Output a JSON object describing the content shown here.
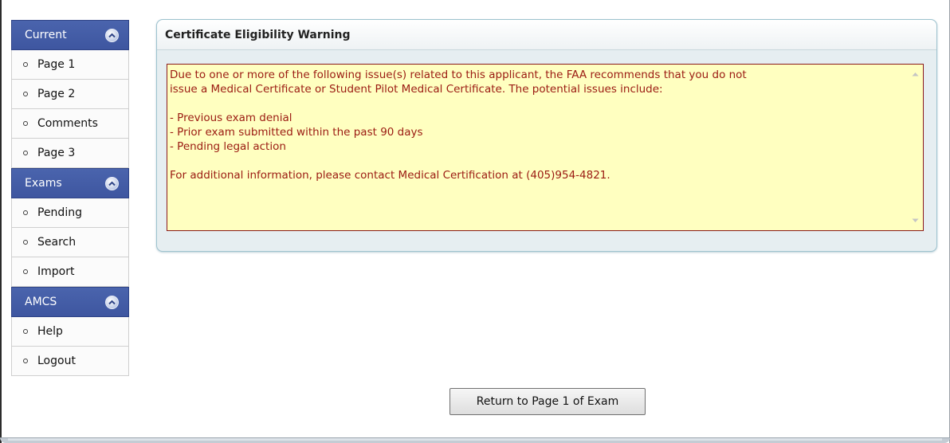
{
  "sidebar": {
    "sections": [
      {
        "title": "Current",
        "items": [
          "Page 1",
          "Page 2",
          "Comments",
          "Page 3"
        ]
      },
      {
        "title": "Exams",
        "items": [
          "Pending",
          "Search",
          "Import"
        ]
      },
      {
        "title": "AMCS",
        "items": [
          "Help",
          "Logout"
        ]
      }
    ]
  },
  "warning_panel": {
    "title": "Certificate Eligibility Warning",
    "message": "Due to one or more of the following issue(s) related to this applicant, the FAA recommends that you do not\nissue a Medical Certificate or Student Pilot Medical Certificate. The potential issues include:\n\n- Previous exam denial\n- Prior exam submitted within the past 90 days\n- Pending legal action\n\nFor additional information, please contact Medical Certification at (405)954-4821."
  },
  "return_button": {
    "label": "Return to Page 1 of Exam"
  },
  "colors": {
    "nav_header": "#4a64ad",
    "warning_text": "#9b1b12",
    "warning_background": "#ffffc0",
    "warning_border": "#8a1a1a"
  }
}
